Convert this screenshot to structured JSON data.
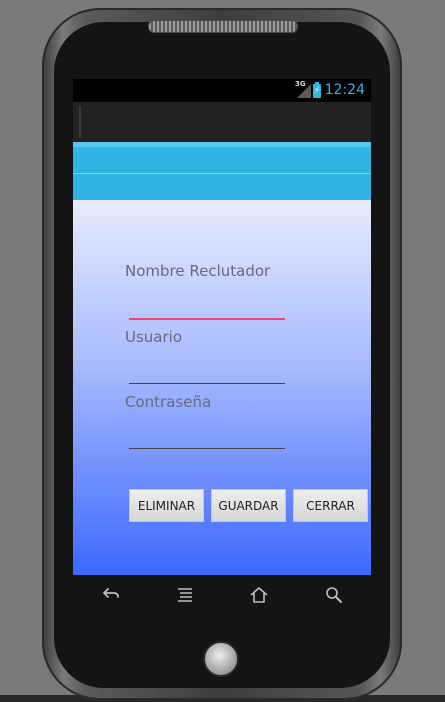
{
  "status_bar": {
    "time": "12:24",
    "network": "3G"
  },
  "form": {
    "fields": [
      {
        "label": "Nombre Reclutador",
        "value": ""
      },
      {
        "label": "Usuario",
        "value": ""
      },
      {
        "label": "Contraseña",
        "value": ""
      }
    ],
    "buttons": {
      "delete": "ELIMINAR",
      "save": "GUARDAR",
      "close": "CERRAR"
    }
  },
  "colors": {
    "accent": "#2fb4e4",
    "status_text": "#33b5e5",
    "focused_underline": "#f0447b",
    "gradient_top": "#e8ecfe",
    "gradient_bottom": "#3d68fe"
  },
  "navigation": {
    "icons": [
      "back-icon",
      "menu-icon",
      "home-icon",
      "search-icon"
    ]
  }
}
